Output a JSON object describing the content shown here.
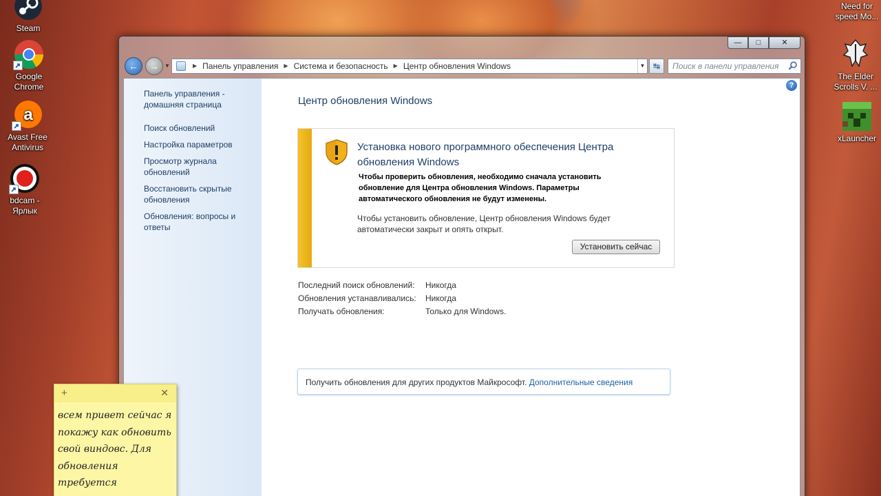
{
  "desktop": {
    "left_icons": [
      {
        "label": "Steam"
      },
      {
        "label": "Google Chrome"
      },
      {
        "label": "Avast Free Antivirus"
      },
      {
        "label": "bdcam - Ярлык"
      }
    ],
    "right_icons": [
      {
        "label": "Need for speed Mo..."
      },
      {
        "label": "The Elder Scrolls V. ..."
      },
      {
        "label": "xLauncher"
      }
    ]
  },
  "window": {
    "address": {
      "crumbs": [
        "Панель управления",
        "Система и безопасность",
        "Центр обновления Windows"
      ]
    },
    "search": {
      "placeholder": "Поиск в панели управления"
    },
    "sidebar": {
      "items": [
        {
          "label": "Панель управления - домашняя страница"
        },
        {
          "label": "Поиск обновлений"
        },
        {
          "label": "Настройка параметров"
        },
        {
          "label": "Просмотр журнала обновлений"
        },
        {
          "label": "Восстановить скрытые обновления"
        },
        {
          "label": "Обновления: вопросы и ответы"
        }
      ]
    },
    "main": {
      "title": "Центр обновления Windows",
      "alert": {
        "heading": "Установка нового программного обеспечения Центра обновления Windows",
        "bold_text": "Чтобы проверить обновления, необходимо сначала установить обновление для Центра обновления Windows. Параметры автоматического обновления не будут изменены.",
        "text": "Чтобы установить обновление, Центр обновления Windows будет автоматически закрыт и опять открыт.",
        "button": "Установить сейчас"
      },
      "info": [
        {
          "label": "Последний поиск обновлений:",
          "value": "Никогда"
        },
        {
          "label": "Обновления устанавливались:",
          "value": "Никогда"
        },
        {
          "label": "Получать обновления:",
          "value": "Только для Windows."
        }
      ],
      "more": {
        "text": "Получить обновления для других продуктов Майкрософт.",
        "link": "Дополнительные сведения"
      }
    }
  },
  "sticky_note": {
    "text": "всем привет сейчас я покажу как обновить свой виндовс. Для обновления требуется"
  },
  "colors": {
    "link": "#1e3f66",
    "alert_stripe": "#f5c22a",
    "note_bg": "#fdf7a5"
  }
}
